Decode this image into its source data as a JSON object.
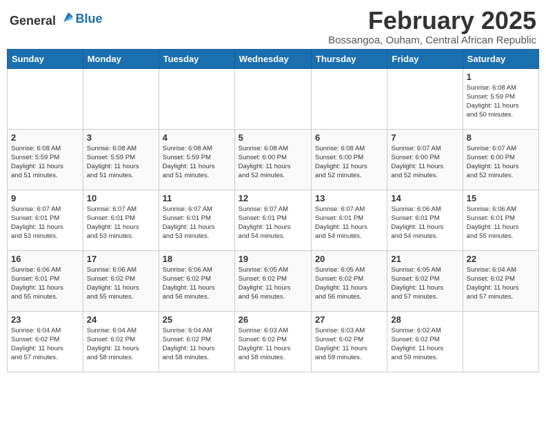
{
  "header": {
    "logo_general": "General",
    "logo_blue": "Blue",
    "month_title": "February 2025",
    "location": "Bossangoa, Ouham, Central African Republic"
  },
  "weekdays": [
    "Sunday",
    "Monday",
    "Tuesday",
    "Wednesday",
    "Thursday",
    "Friday",
    "Saturday"
  ],
  "weeks": [
    [
      {
        "day": "",
        "info": ""
      },
      {
        "day": "",
        "info": ""
      },
      {
        "day": "",
        "info": ""
      },
      {
        "day": "",
        "info": ""
      },
      {
        "day": "",
        "info": ""
      },
      {
        "day": "",
        "info": ""
      },
      {
        "day": "1",
        "info": "Sunrise: 6:08 AM\nSunset: 5:59 PM\nDaylight: 11 hours\nand 50 minutes."
      }
    ],
    [
      {
        "day": "2",
        "info": "Sunrise: 6:08 AM\nSunset: 5:59 PM\nDaylight: 11 hours\nand 51 minutes."
      },
      {
        "day": "3",
        "info": "Sunrise: 6:08 AM\nSunset: 5:59 PM\nDaylight: 11 hours\nand 51 minutes."
      },
      {
        "day": "4",
        "info": "Sunrise: 6:08 AM\nSunset: 5:59 PM\nDaylight: 11 hours\nand 51 minutes."
      },
      {
        "day": "5",
        "info": "Sunrise: 6:08 AM\nSunset: 6:00 PM\nDaylight: 11 hours\nand 52 minutes."
      },
      {
        "day": "6",
        "info": "Sunrise: 6:08 AM\nSunset: 6:00 PM\nDaylight: 11 hours\nand 52 minutes."
      },
      {
        "day": "7",
        "info": "Sunrise: 6:07 AM\nSunset: 6:00 PM\nDaylight: 11 hours\nand 52 minutes."
      },
      {
        "day": "8",
        "info": "Sunrise: 6:07 AM\nSunset: 6:00 PM\nDaylight: 11 hours\nand 52 minutes."
      }
    ],
    [
      {
        "day": "9",
        "info": "Sunrise: 6:07 AM\nSunset: 6:01 PM\nDaylight: 11 hours\nand 53 minutes."
      },
      {
        "day": "10",
        "info": "Sunrise: 6:07 AM\nSunset: 6:01 PM\nDaylight: 11 hours\nand 53 minutes."
      },
      {
        "day": "11",
        "info": "Sunrise: 6:07 AM\nSunset: 6:01 PM\nDaylight: 11 hours\nand 53 minutes."
      },
      {
        "day": "12",
        "info": "Sunrise: 6:07 AM\nSunset: 6:01 PM\nDaylight: 11 hours\nand 54 minutes."
      },
      {
        "day": "13",
        "info": "Sunrise: 6:07 AM\nSunset: 6:01 PM\nDaylight: 11 hours\nand 54 minutes."
      },
      {
        "day": "14",
        "info": "Sunrise: 6:06 AM\nSunset: 6:01 PM\nDaylight: 11 hours\nand 54 minutes."
      },
      {
        "day": "15",
        "info": "Sunrise: 6:06 AM\nSunset: 6:01 PM\nDaylight: 11 hours\nand 55 minutes."
      }
    ],
    [
      {
        "day": "16",
        "info": "Sunrise: 6:06 AM\nSunset: 6:01 PM\nDaylight: 11 hours\nand 55 minutes."
      },
      {
        "day": "17",
        "info": "Sunrise: 6:06 AM\nSunset: 6:02 PM\nDaylight: 11 hours\nand 55 minutes."
      },
      {
        "day": "18",
        "info": "Sunrise: 6:06 AM\nSunset: 6:02 PM\nDaylight: 11 hours\nand 56 minutes."
      },
      {
        "day": "19",
        "info": "Sunrise: 6:05 AM\nSunset: 6:02 PM\nDaylight: 11 hours\nand 56 minutes."
      },
      {
        "day": "20",
        "info": "Sunrise: 6:05 AM\nSunset: 6:02 PM\nDaylight: 11 hours\nand 56 minutes."
      },
      {
        "day": "21",
        "info": "Sunrise: 6:05 AM\nSunset: 6:02 PM\nDaylight: 11 hours\nand 57 minutes."
      },
      {
        "day": "22",
        "info": "Sunrise: 6:04 AM\nSunset: 6:02 PM\nDaylight: 11 hours\nand 57 minutes."
      }
    ],
    [
      {
        "day": "23",
        "info": "Sunrise: 6:04 AM\nSunset: 6:02 PM\nDaylight: 11 hours\nand 57 minutes."
      },
      {
        "day": "24",
        "info": "Sunrise: 6:04 AM\nSunset: 6:02 PM\nDaylight: 11 hours\nand 58 minutes."
      },
      {
        "day": "25",
        "info": "Sunrise: 6:04 AM\nSunset: 6:02 PM\nDaylight: 11 hours\nand 58 minutes."
      },
      {
        "day": "26",
        "info": "Sunrise: 6:03 AM\nSunset: 6:02 PM\nDaylight: 11 hours\nand 58 minutes."
      },
      {
        "day": "27",
        "info": "Sunrise: 6:03 AM\nSunset: 6:02 PM\nDaylight: 11 hours\nand 59 minutes."
      },
      {
        "day": "28",
        "info": "Sunrise: 6:02 AM\nSunset: 6:02 PM\nDaylight: 11 hours\nand 59 minutes."
      },
      {
        "day": "",
        "info": ""
      }
    ]
  ]
}
